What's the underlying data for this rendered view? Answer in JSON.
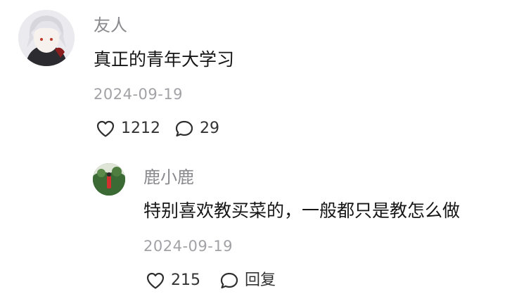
{
  "comments": [
    {
      "author": "友人",
      "text": "真正的青年大学习",
      "date": "2024-09-19",
      "likes": "1212",
      "replies": "29"
    }
  ],
  "replies": [
    {
      "author": "鹿小鹿",
      "text": "特别喜欢教买菜的，一般都只是教怎么做",
      "date": "2024-09-19",
      "likes": "215",
      "reply_label": "回复"
    }
  ],
  "icons": {
    "like": "heart-outline-icon",
    "comment": "speech-bubble-icon"
  },
  "colors": {
    "name": "#8a8a8e",
    "text": "#161616",
    "date": "#a2a2a6",
    "action": "#333333"
  }
}
